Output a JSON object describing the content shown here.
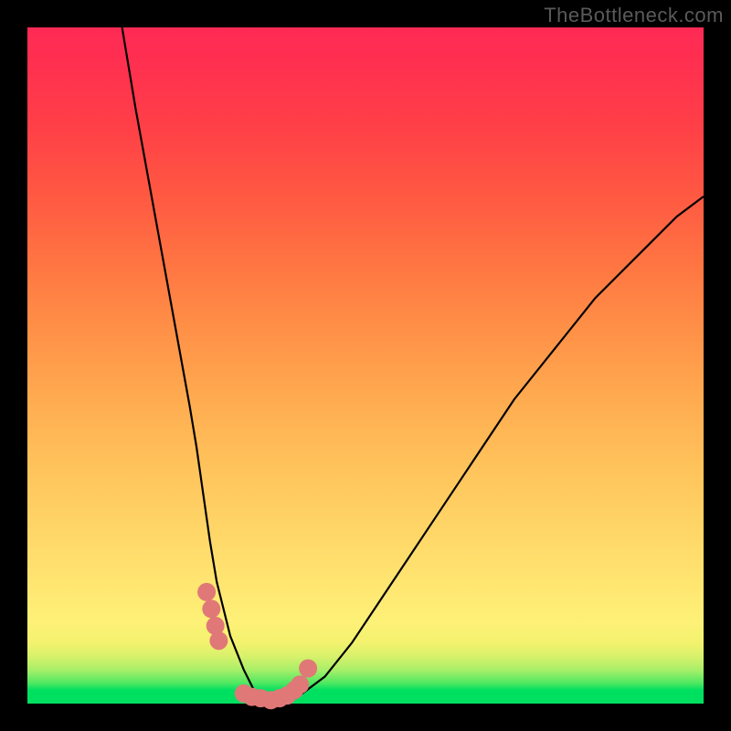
{
  "watermark": "TheBottleneck.com",
  "chart_data": {
    "type": "line",
    "title": "",
    "xlabel": "",
    "ylabel": "",
    "xlim": [
      0,
      100
    ],
    "ylim": [
      0,
      100
    ],
    "series": [
      {
        "name": "bottleneck-curve",
        "x": [
          14,
          16,
          18,
          20,
          22,
          24,
          25,
          26,
          27,
          28,
          30,
          32,
          34,
          36,
          38,
          40,
          44,
          48,
          52,
          56,
          60,
          64,
          68,
          72,
          76,
          80,
          84,
          88,
          92,
          96,
          100
        ],
        "values": [
          100,
          88,
          77,
          66,
          55,
          44,
          38,
          31,
          24,
          18,
          10,
          5,
          1,
          0,
          0,
          1,
          4,
          9,
          15,
          21,
          27,
          33,
          39,
          45,
          50,
          55,
          60,
          64,
          68,
          72,
          75
        ]
      }
    ],
    "markers": [
      {
        "name": "left-cluster",
        "points": [
          [
            26.5,
            16.5
          ],
          [
            27.2,
            14.0
          ],
          [
            27.8,
            11.5
          ],
          [
            28.3,
            9.3
          ]
        ]
      },
      {
        "name": "bottom-cluster",
        "points": [
          [
            32.0,
            1.5
          ],
          [
            33.2,
            1.0
          ],
          [
            34.5,
            0.8
          ],
          [
            36.0,
            0.5
          ],
          [
            37.3,
            0.8
          ],
          [
            38.4,
            1.2
          ],
          [
            39.5,
            2.0
          ],
          [
            40.3,
            2.8
          ]
        ]
      },
      {
        "name": "right-tip",
        "points": [
          [
            41.5,
            5.2
          ]
        ]
      }
    ],
    "marker_color": "#e07878",
    "marker_radius_px": 10
  }
}
